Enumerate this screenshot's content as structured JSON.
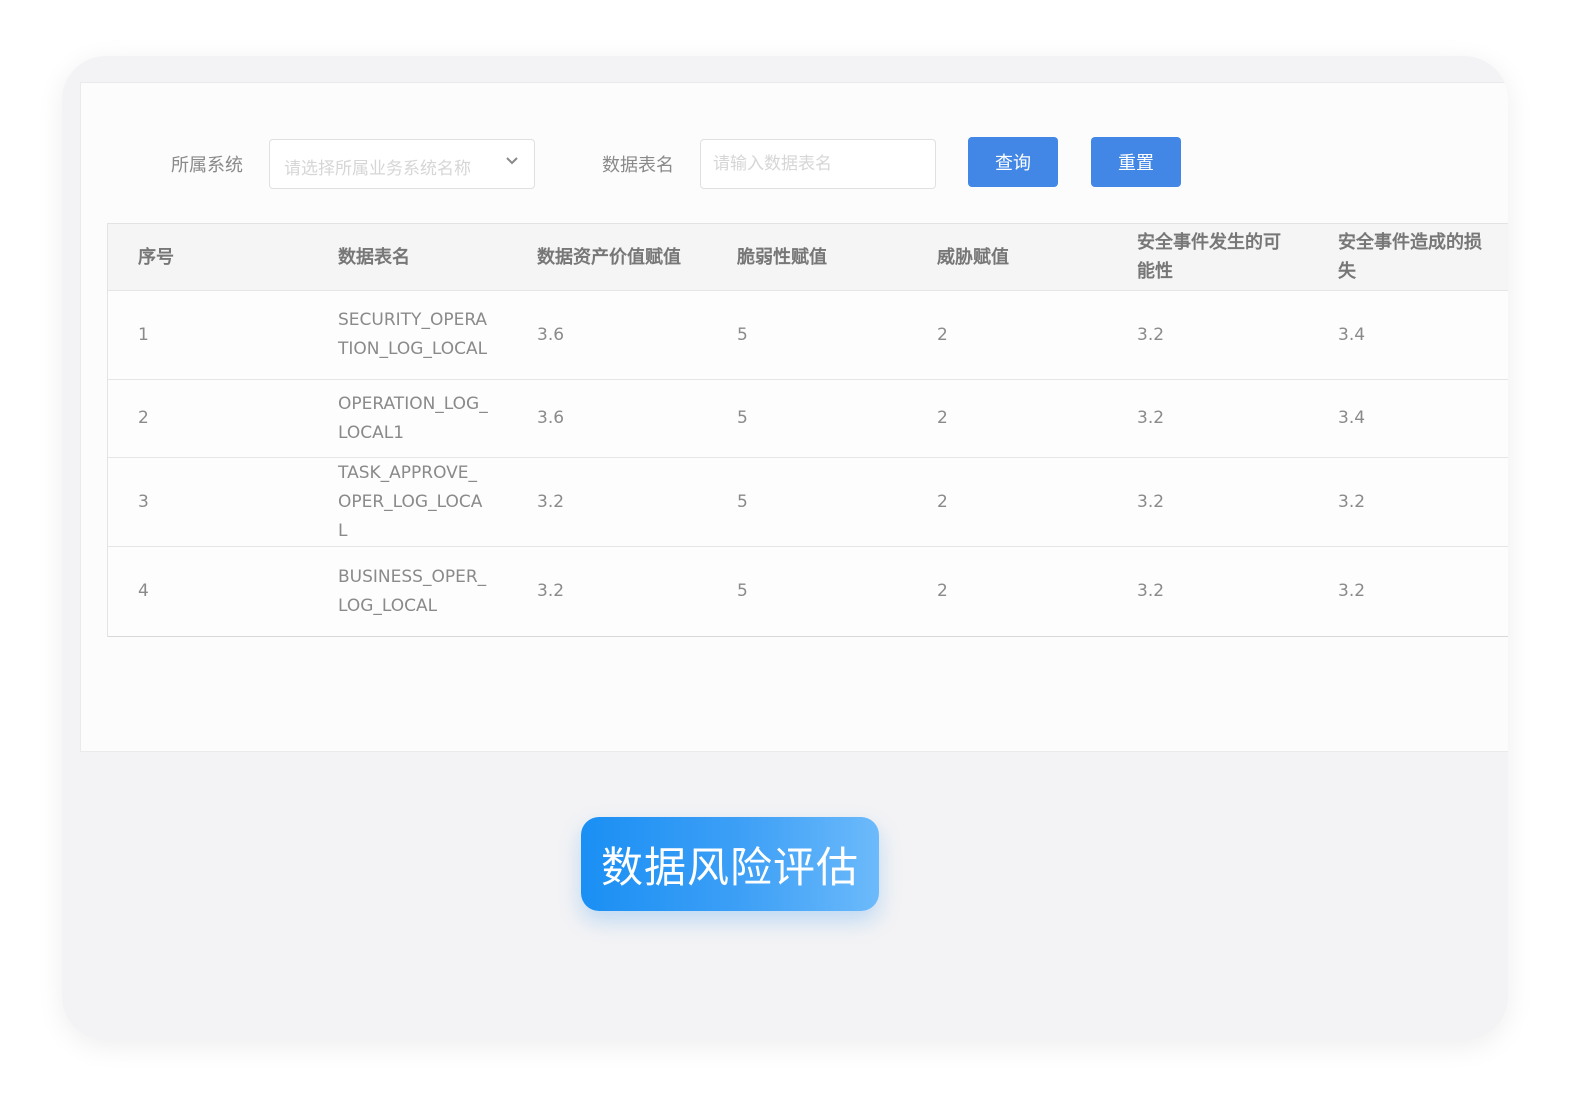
{
  "filters": {
    "system_label": "所属系统",
    "system_placeholder": "请选择所属业务系统名称",
    "table_label": "数据表名",
    "table_placeholder": "请输入数据表名",
    "query_button": "查询",
    "reset_button": "重置"
  },
  "table": {
    "columns": [
      "序号",
      "数据表名",
      "数据资产价值赋值",
      "脆弱性赋值",
      "威胁赋值",
      "安全事件发生的可能性",
      "安全事件造成的损失"
    ],
    "rows": [
      [
        "1",
        "SECURITY_OPERATION_LOG_LOCAL",
        "3.6",
        "5",
        "2",
        "3.2",
        "3.4"
      ],
      [
        "2",
        "OPERATION_LOG_LOCAL1",
        "3.6",
        "5",
        "2",
        "3.2",
        "3.4"
      ],
      [
        "3",
        "TASK_APPROVE_OPER_LOG_LOCAL",
        "3.2",
        "5",
        "2",
        "3.2",
        "3.2"
      ],
      [
        "4",
        "BUSINESS_OPER_LOG_LOCAL",
        "3.2",
        "5",
        "2",
        "3.2",
        "3.2"
      ]
    ]
  },
  "caption": "数据风险评估",
  "colors": {
    "accent": "#4287e6",
    "caption_gradient_start": "#1a8ff4",
    "caption_gradient_end": "#6cbafb"
  }
}
